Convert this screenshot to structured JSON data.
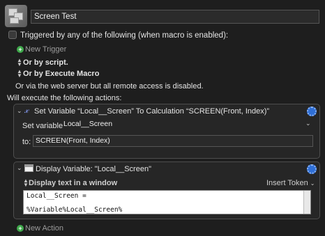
{
  "macro": {
    "name": "Screen Test"
  },
  "triggers": {
    "trigger_label": "Triggered by any of the following (when macro is enabled):",
    "new_trigger": "New Trigger",
    "by_script": "Or by script.",
    "by_execute_macro": "Or by Execute Macro",
    "web_server_note": "Or via the web server but all remote access is disabled."
  },
  "actions_heading": "Will execute the following actions:",
  "actions": [
    {
      "title": "Set Variable “Local__Screen” To Calculation “SCREEN(Front, Index)”",
      "set_variable_label": "Set variable",
      "variable_value": "Local__Screen",
      "to_label": "to:",
      "to_value": "SCREEN(Front, Index)"
    },
    {
      "title": "Display Variable: \"Local__Screen\"",
      "display_mode": "Display text in a window",
      "insert_token": "Insert Token",
      "text_lines": [
        "Local__Screen =",
        "",
        "%Variable%Local__Screen%"
      ]
    }
  ],
  "new_action": "New Action",
  "icons": {
    "calc": "x-variable-icon",
    "window": "window-icon",
    "gear": "gear-icon"
  },
  "colors": {
    "background": "#1e1e1e",
    "accent_green": "#3fa94b",
    "gear_blue": "#2f6fd6"
  }
}
